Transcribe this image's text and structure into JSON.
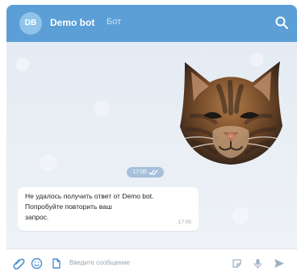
{
  "header": {
    "avatar_initials": "DB",
    "title": "Demo bot",
    "subtitle": "Бот",
    "search_icon": "search-icon"
  },
  "chat": {
    "sticker_icon": "cat-sticker",
    "sent_time": "17:05",
    "message": {
      "lines": [
        "Не удалось получить ответ от Demo bot.",
        "Попробуйте повторить ваш",
        "запрос."
      ],
      "time": "17:05"
    }
  },
  "composer": {
    "placeholder": "Введите сообщение",
    "icons": {
      "left": [
        "paperclip-icon",
        "emoji-icon",
        "file-icon"
      ],
      "right": [
        "sticker-icon",
        "mic-icon",
        "send-icon"
      ]
    }
  },
  "colors": {
    "header": "#5b9fd6",
    "chat_background": "#e8edf4",
    "message_background": "#ffffff",
    "placeholder": "#9aa6b2"
  }
}
